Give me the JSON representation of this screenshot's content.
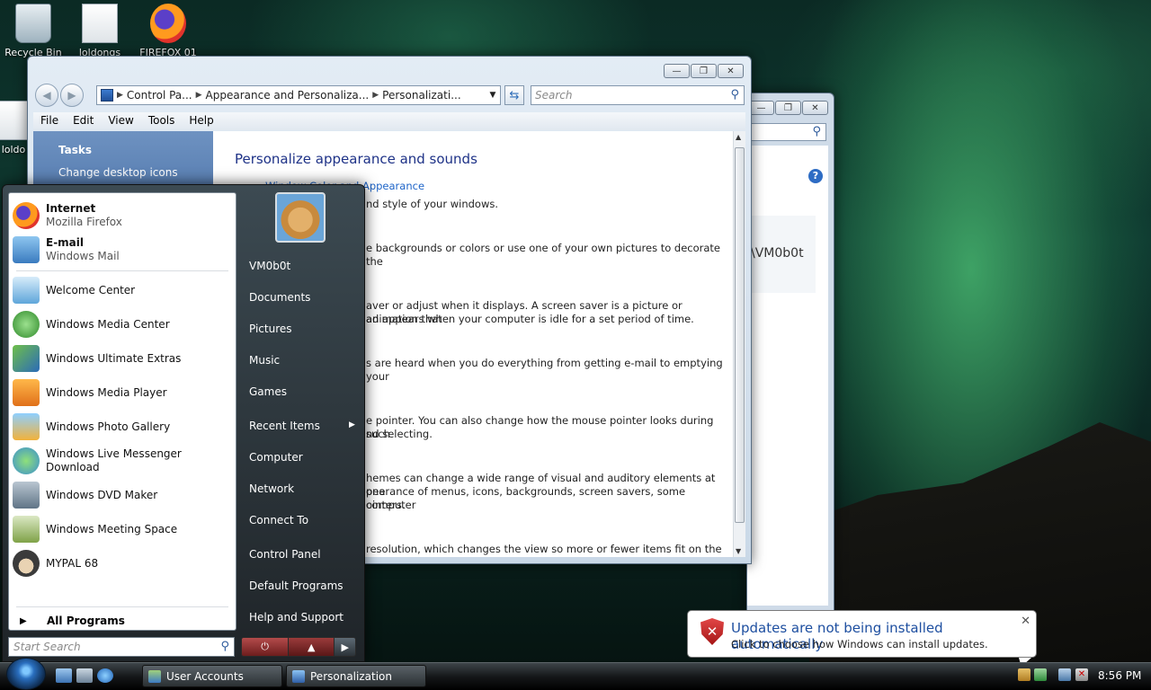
{
  "desktop": {
    "icons": [
      {
        "label": "Recycle Bin"
      },
      {
        "label": "loldongs"
      },
      {
        "label": "FIREFOX 01"
      },
      {
        "label": "loldo"
      }
    ]
  },
  "window": {
    "address": {
      "crumbs": [
        "Control Pa...",
        "Appearance and Personaliza...",
        "Personalizati..."
      ]
    },
    "search_placeholder": "Search",
    "menu": [
      "File",
      "Edit",
      "View",
      "Tools",
      "Help"
    ],
    "tasks": {
      "title": "Tasks",
      "link": "Change desktop icons"
    },
    "content": {
      "heading": "Personalize appearance and sounds",
      "link": "Window Color and Appearance",
      "lines": [
        "nd style of your windows.",
        "e backgrounds or colors or use one of your own pictures to decorate the",
        "aver or adjust when it displays. A screen saver is a picture or animation that",
        "ad appears when your computer is idle for a set period of time.",
        "s are heard when you do everything from getting e-mail to emptying your",
        "e pointer. You can also change how the mouse pointer looks during such",
        "nd selecting.",
        "hemes can change a wide range of visual and auditory elements at one",
        "pearance of menus, icons, backgrounds, screen savers, some computer",
        "ointers.",
        "resolution, which changes the view so more or fewer items fit on the"
      ]
    },
    "back_window_text": "\\VM0b0t"
  },
  "start_menu": {
    "pinned": [
      {
        "title": "Internet",
        "subtitle": "Mozilla Firefox"
      },
      {
        "title": "E-mail",
        "subtitle": "Windows Mail"
      }
    ],
    "recent": [
      "Welcome Center",
      "Windows Media Center",
      "Windows Ultimate Extras",
      "Windows Media Player",
      "Windows Photo Gallery",
      "Windows Live Messenger Download",
      "Windows DVD Maker",
      "Windows Meeting Space",
      "MYPAL 68"
    ],
    "all_programs": "All Programs",
    "search_placeholder": "Start Search",
    "right": {
      "user": "VM0b0t",
      "items": [
        "Documents",
        "Pictures",
        "Music",
        "Games",
        "Recent Items",
        "Computer",
        "Network",
        "Connect To",
        "Control Panel",
        "Default Programs",
        "Help and Support"
      ]
    }
  },
  "balloon": {
    "title": "Updates are not being installed automatically",
    "subtitle": "Click to choose how Windows can install updates."
  },
  "taskbar": {
    "buttons": [
      "User Accounts",
      "Personalization"
    ],
    "clock": "8:56 PM"
  },
  "colors": {
    "accent": "#1e3287",
    "link": "#1e64c8",
    "balloon_title": "#1e4fa0"
  }
}
